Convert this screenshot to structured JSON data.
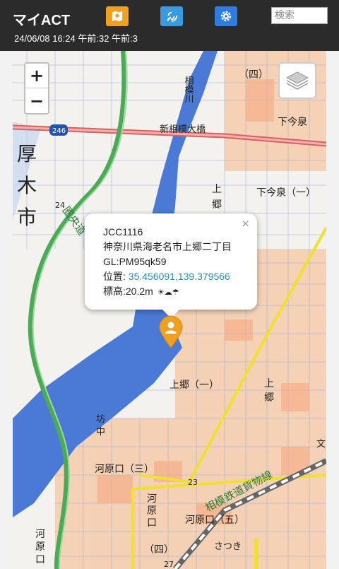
{
  "header": {
    "title": "マイACT",
    "status": "24/06/08 16:24 午前:32 午前:3",
    "search_placeholder": "検索"
  },
  "map": {
    "labels": {
      "river": "相模川",
      "bridge": "新相模大橋",
      "city": [
        "厚",
        "木",
        "市"
      ],
      "shimoimaizumi": "下今泉",
      "shimoimaizumi_1": "下今泉（一）",
      "kamigo_v": [
        "上",
        "郷"
      ],
      "kamigo_1": "上郷（一）",
      "kamigo_v2": [
        "上",
        "郷"
      ],
      "kawaraguchi_3": "河原口（三）",
      "kawaraguchi_v": [
        "河",
        "原",
        "口"
      ],
      "kawaraguchi_4": "（四）",
      "kawaraguchi_5": "河原口（五）",
      "kawaraguchi_v2": [
        "河",
        "原",
        "口"
      ],
      "rail": "相模鉄道貨物線",
      "route": "246",
      "shi_4": "（四）",
      "bou": [
        "坊",
        "中"
      ],
      "num_24": "24",
      "num_23": "23",
      "num_27": "27",
      "satsuki": "さつき",
      "bun": "文",
      "enkan": "圏央道"
    }
  },
  "popup": {
    "code": "JCC1116",
    "address": "神奈川県海老名市上郷二丁目",
    "gl": "GL:PM95qk59",
    "pos_label": "位置: ",
    "pos_value": "35.456091,139.379566",
    "elev": "標高:20.2m",
    "weather": "☀☁☂",
    "close": "×"
  },
  "zoom": {
    "in": "+",
    "out": "−"
  },
  "colors": {
    "river": "#4a7ad6",
    "highway": "#4aaa55",
    "red_road": "#e07070",
    "yellow_road": "#f0e030",
    "marker": "#f0a020"
  }
}
